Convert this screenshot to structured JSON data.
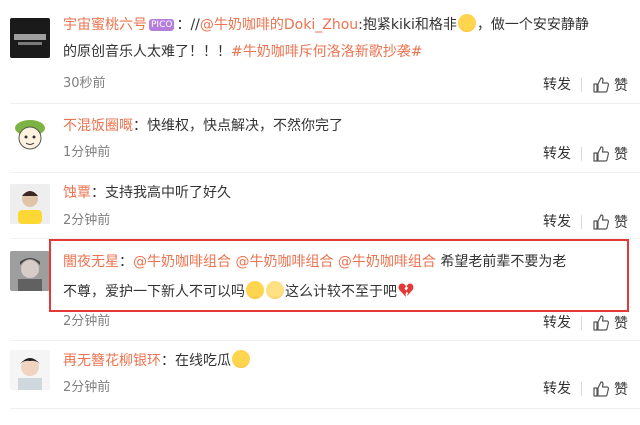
{
  "comments": [
    {
      "user": "宇宙蜜桃六号",
      "badge": "PICO",
      "colon": "：",
      "prefix": "//",
      "mention": "@牛奶咖啡的Doki_Zhou",
      "text1": ":抱紧kiki和格非",
      "text2": "，做一个安安静静",
      "text3": "的原创音乐人太难了！！！",
      "topic": "#牛奶咖啡斥何洛洛新歌抄袭#",
      "time": "30秒前",
      "repost": "转发",
      "like": "赞"
    },
    {
      "user": "不混饭圈嘅",
      "colon": "：",
      "text": "快维权，快点解决，不然你完了",
      "time": "1分钟前",
      "repost": "转发",
      "like": "赞"
    },
    {
      "user": "蚀覃",
      "colon": "：",
      "text": "支持我高中听了好久",
      "time": "2分钟前",
      "repost": "转发",
      "like": "赞"
    },
    {
      "user": "闇夜无星",
      "colon": "：",
      "mention1": "@牛奶咖啡组合",
      "mention2": "@牛奶咖啡组合",
      "mention3": "@牛奶咖啡组合",
      "text1": "希望老前辈不要为老",
      "text2": "不尊，爱护一下新人不可以吗",
      "text3": "这么计较不至于吧",
      "time": "2分钟前",
      "repost": "转发",
      "like": "赞"
    },
    {
      "user": "再无簪花柳银环",
      "colon": "：",
      "text": "在线吃瓜",
      "time": "2分钟前",
      "repost": "转发",
      "like": "赞"
    }
  ],
  "colors": {
    "username": "#eb7350",
    "text": "#333333",
    "meta": "#808080",
    "highlight_border": "#e53935"
  },
  "icons": [
    "thumbs-up-icon",
    "crying-emoji-icon",
    "pleading-emoji-icon",
    "broken-heart-icon",
    "savoring-emoji-icon"
  ]
}
